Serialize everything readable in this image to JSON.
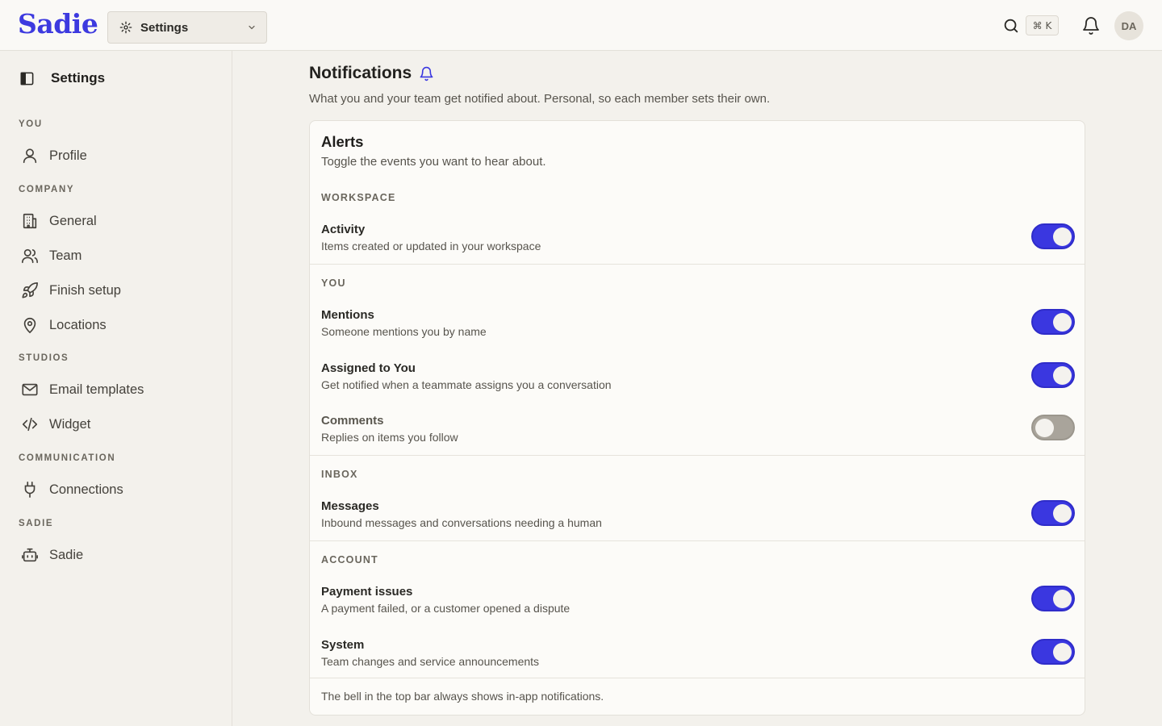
{
  "topbar": {
    "logo": "Sadie",
    "workspace_select": "Settings",
    "shortcut": "⌘ K",
    "avatar_initials": "DA"
  },
  "sidebar": {
    "title": "Settings",
    "sections": [
      {
        "label": "YOU",
        "items": [
          {
            "label": "Profile",
            "icon": "user-icon"
          }
        ]
      },
      {
        "label": "COMPANY",
        "items": [
          {
            "label": "General",
            "icon": "building-icon"
          },
          {
            "label": "Team",
            "icon": "users-icon"
          },
          {
            "label": "Finish setup",
            "icon": "rocket-icon"
          },
          {
            "label": "Locations",
            "icon": "map-pin-icon"
          }
        ]
      },
      {
        "label": "STUDIOS",
        "items": [
          {
            "label": "Email templates",
            "icon": "mail-icon"
          },
          {
            "label": "Widget",
            "icon": "code-icon"
          }
        ]
      },
      {
        "label": "COMMUNICATION",
        "items": [
          {
            "label": "Connections",
            "icon": "plug-icon"
          }
        ]
      },
      {
        "label": "SADIE",
        "items": [
          {
            "label": "Sadie",
            "icon": "bot-icon"
          }
        ]
      }
    ]
  },
  "main": {
    "title": "Notifications",
    "description": "What you and your team get notified about. Personal, so each member sets their own.",
    "card": {
      "title": "Alerts",
      "subtitle": "Toggle the events you want to hear about.",
      "groups": [
        {
          "label": "WORKSPACE",
          "rows": [
            {
              "title": "Activity",
              "desc": "Items created or updated in your workspace",
              "enabled": true
            }
          ]
        },
        {
          "label": "YOU",
          "rows": [
            {
              "title": "Mentions",
              "desc": "Someone mentions you by name",
              "enabled": true
            },
            {
              "title": "Assigned to You",
              "desc": "Get notified when a teammate assigns you a conversation",
              "enabled": true
            },
            {
              "title": "Comments",
              "desc": "Replies on items you follow",
              "enabled": false
            }
          ]
        },
        {
          "label": "INBOX",
          "rows": [
            {
              "title": "Messages",
              "desc": "Inbound messages and conversations needing a human",
              "enabled": true
            }
          ]
        },
        {
          "label": "ACCOUNT",
          "rows": [
            {
              "title": "Payment issues",
              "desc": "A payment failed, or a customer opened a dispute",
              "enabled": true
            },
            {
              "title": "System",
              "desc": "Team changes and service announcements",
              "enabled": true
            }
          ]
        }
      ],
      "footer": "The bell in the top bar always shows in-app notifications."
    }
  },
  "colors": {
    "accent": "#3a37e0",
    "brand": "#3d3adf",
    "toggle_off": "#a9a49b"
  }
}
